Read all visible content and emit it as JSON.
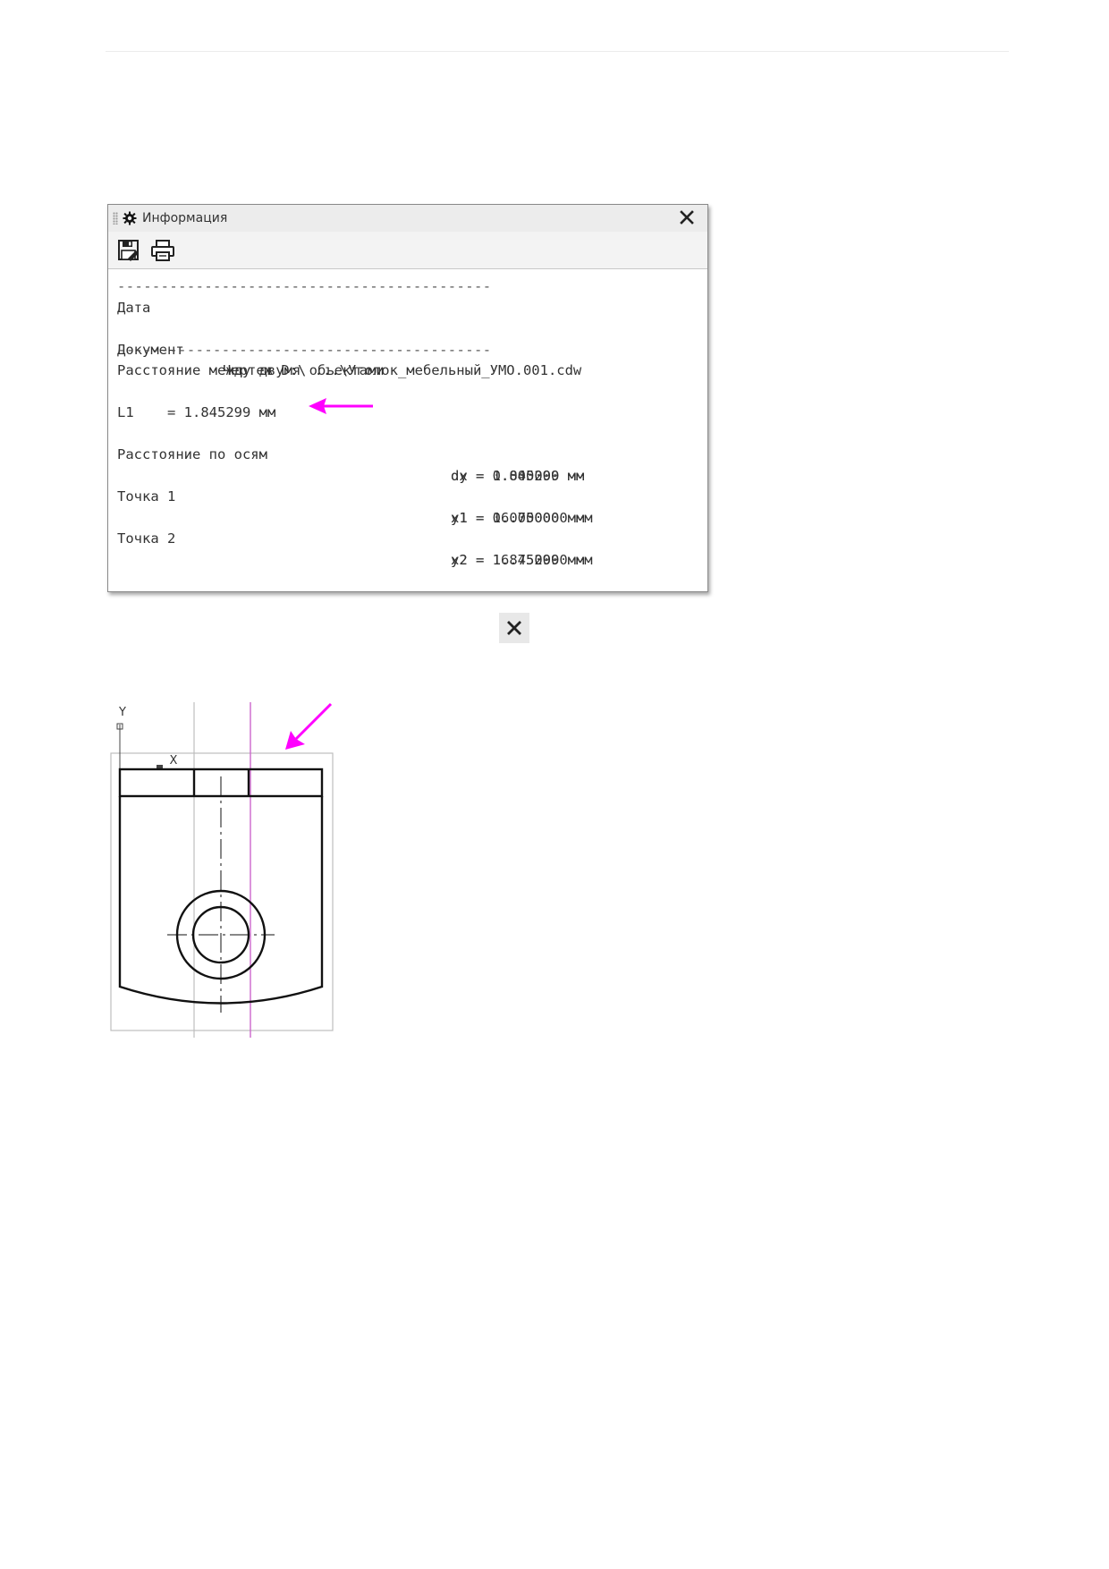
{
  "window": {
    "title": "Информация",
    "icons": {
      "title": "gear-icon",
      "close": "close-icon",
      "save": "save-icon",
      "print": "printer-icon"
    }
  },
  "report": {
    "separator": "-------------------------------------------",
    "date_label": "Дата",
    "document_label": "Документ",
    "document_value": "Чертеж D:\\ ...\\Уголок_мебельный_УМО.001.cdw",
    "heading": "Расстояние между двумя объектами",
    "l1": "L1    = 1.845299 мм",
    "axes_label": "Расстояние по осям",
    "dx": "dx = 1.845299 мм",
    "dy": "dy = 0.000000 мм",
    "point1_label": "Точка 1",
    "x1": "x1 = 0.000000 мм",
    "y1": "y1 = 16.750000 мм",
    "point2_label": "Точка 2",
    "x2": "x2 = 1.845299 мм",
    "y2": "y2 = 16.750000 мм"
  },
  "drawing": {
    "axis_y": "Y",
    "axis_x": "X"
  },
  "colors": {
    "accent_arrow": "#ff00ff",
    "guide_line": "#cc66cc",
    "titlebar": "#ececec"
  }
}
